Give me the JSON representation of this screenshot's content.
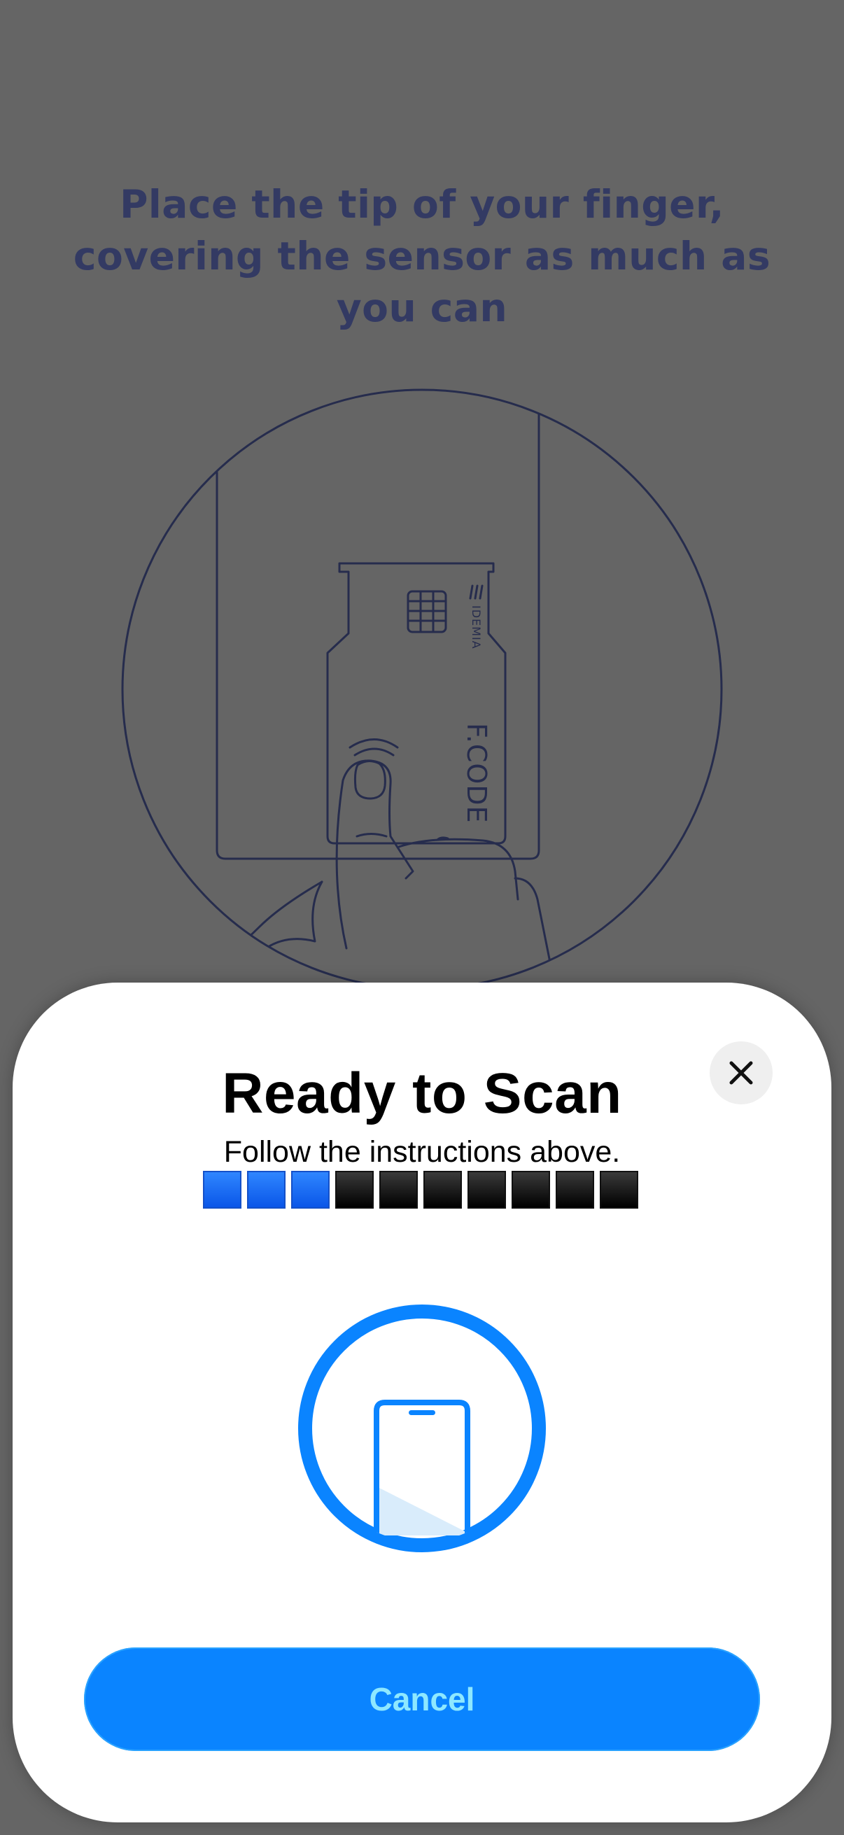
{
  "instruction": {
    "text": "Place the tip of your finger, covering the sensor as much as you can"
  },
  "illustration": {
    "card_brand": "F.CODE",
    "card_issuer": "IDEMIA",
    "icon": "finger-on-card-sensor-illustration"
  },
  "scan_sheet": {
    "title": "Ready to Scan",
    "subtitle": "Follow the instructions above.",
    "progress": {
      "total_segments": 10,
      "filled_segments": 3
    },
    "close_icon": "close-icon",
    "phone_icon": "phone-icon",
    "cancel_label": "Cancel"
  },
  "colors": {
    "accent": "#0A84FF",
    "progress_filled": "#1A6AFF",
    "progress_empty": "#000000",
    "instruction_text": "#333A63",
    "background_dim": "#656565"
  }
}
